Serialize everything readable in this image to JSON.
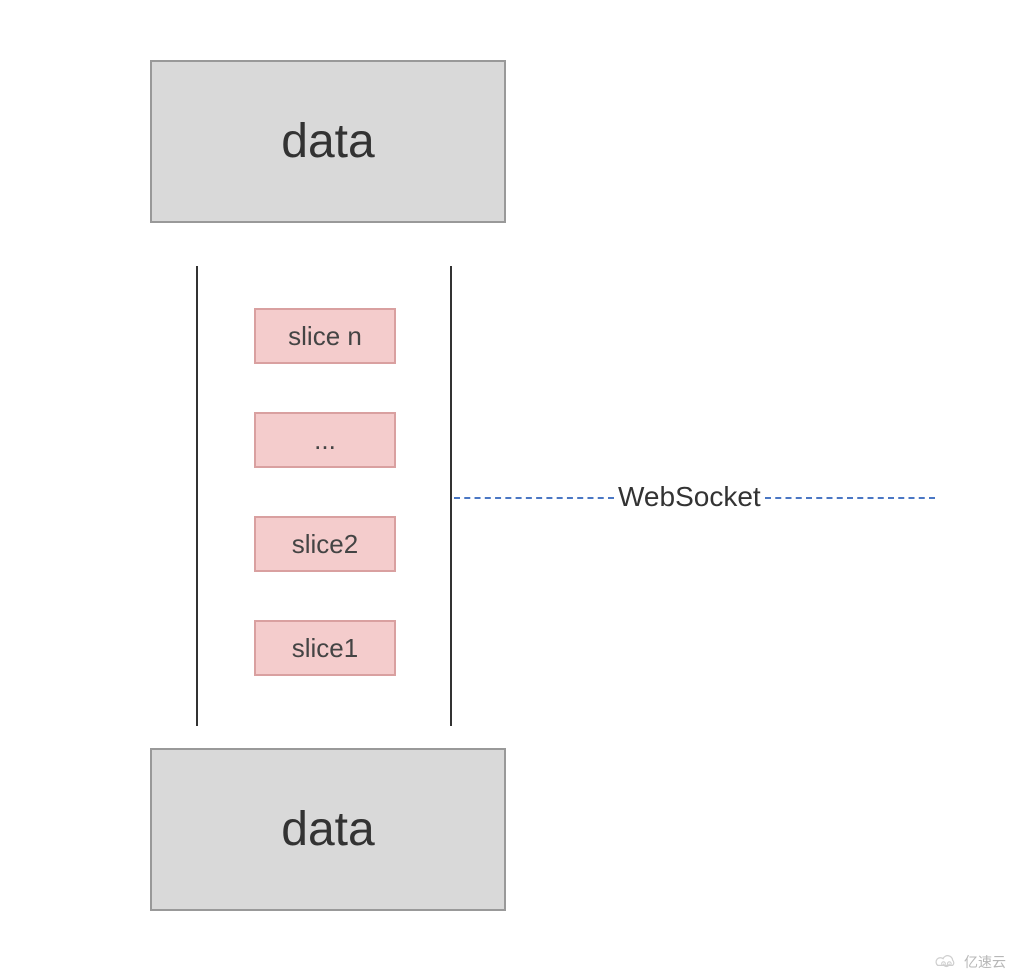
{
  "boxes": {
    "top_label": "data",
    "bottom_label": "data"
  },
  "slices": {
    "items": [
      {
        "label": "slice n"
      },
      {
        "label": "..."
      },
      {
        "label": "slice2"
      },
      {
        "label": "slice1"
      }
    ]
  },
  "connection": {
    "label": "WebSocket"
  },
  "watermark": {
    "text": "亿速云"
  }
}
